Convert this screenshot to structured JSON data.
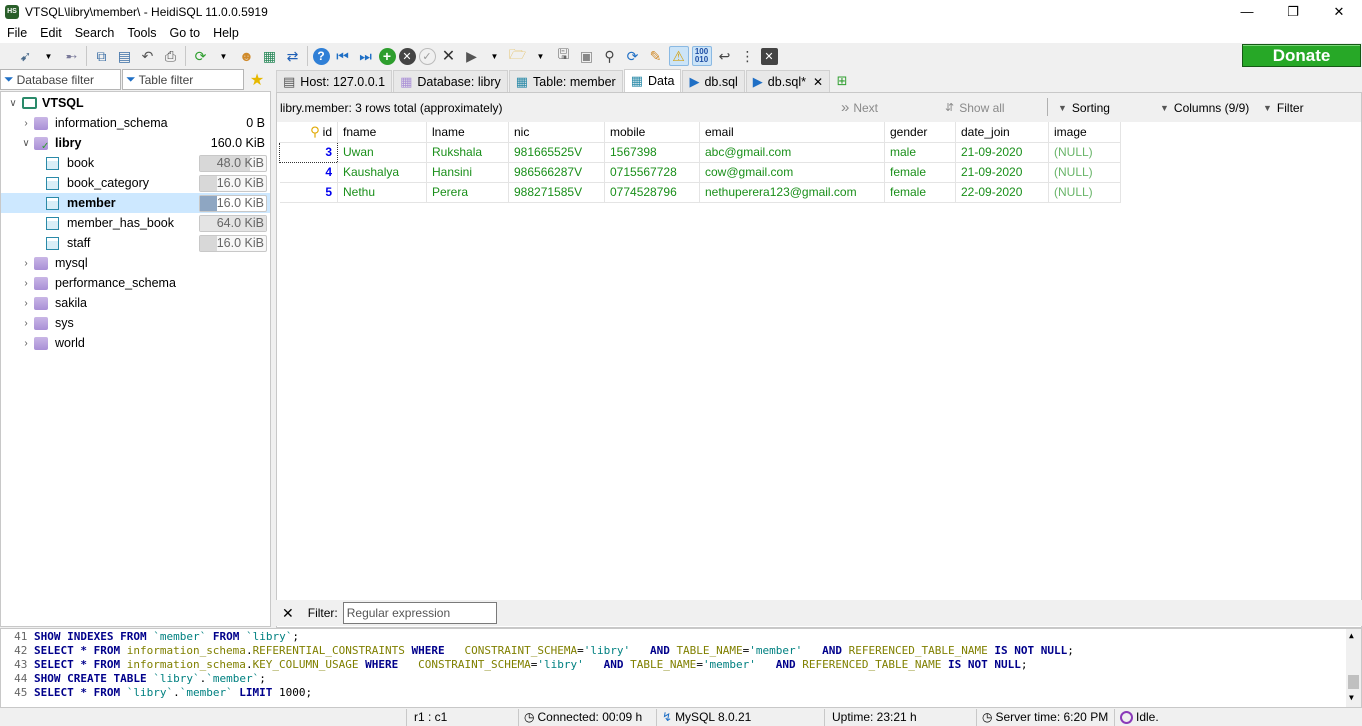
{
  "window": {
    "title": "VTSQL\\libry\\member\\ - HeidiSQL 11.0.0.5919",
    "app_icon_text": "HS"
  },
  "menu": [
    "File",
    "Edit",
    "Search",
    "Tools",
    "Go to",
    "Help"
  ],
  "donate_label": "Donate",
  "filters": {
    "database_filter": "Database filter",
    "table_filter": "Table filter"
  },
  "tabs": [
    {
      "label": "Host: 127.0.0.1",
      "icon": "host-icon"
    },
    {
      "label": "Database: libry",
      "icon": "database-icon"
    },
    {
      "label": "Table: member",
      "icon": "table-icon"
    },
    {
      "label": "Data",
      "icon": "data-grid-icon"
    },
    {
      "label": "db.sql",
      "icon": "play-icon"
    },
    {
      "label": "db.sql*",
      "icon": "play-icon"
    }
  ],
  "tree": {
    "root": "VTSQL",
    "databases": [
      {
        "name": "information_schema",
        "size": "0 B"
      },
      {
        "name": "libry",
        "size": "160.0 KiB",
        "tables": [
          {
            "name": "book",
            "size": "48.0 KiB",
            "fill": 0.75
          },
          {
            "name": "book_category",
            "size": "16.0 KiB",
            "fill": 0.25
          },
          {
            "name": "member",
            "size": "16.0 KiB",
            "fill": 0.25
          },
          {
            "name": "member_has_book",
            "size": "64.0 KiB",
            "fill": 1.0
          },
          {
            "name": "staff",
            "size": "16.0 KiB",
            "fill": 0.25
          }
        ]
      },
      {
        "name": "mysql"
      },
      {
        "name": "performance_schema"
      },
      {
        "name": "sakila"
      },
      {
        "name": "sys"
      },
      {
        "name": "world"
      }
    ]
  },
  "grid": {
    "info": "libry.member: 3 rows total (approximately)",
    "next": "Next",
    "show_all": "Show all",
    "sorting": "Sorting",
    "columns": "Columns (9/9)",
    "filter": "Filter",
    "headers": [
      "id",
      "fname",
      "lname",
      "nic",
      "mobile",
      "email",
      "gender",
      "date_join",
      "image"
    ],
    "rows": [
      [
        "3",
        "Uwan",
        "Rukshala",
        "981665525V",
        "1567398",
        "abc@gmail.com",
        "male",
        "21-09-2020",
        "(NULL)"
      ],
      [
        "4",
        "Kaushalya",
        "Hansini",
        "986566287V",
        "0715567728",
        "cow@gmail.com",
        "female",
        "21-09-2020",
        "(NULL)"
      ],
      [
        "5",
        "Nethu",
        "Perera",
        "988271585V",
        "0774528796",
        "nethuperera123@gmail.com",
        "female",
        "22-09-2020",
        "(NULL)"
      ]
    ]
  },
  "filter_panel": {
    "label": "Filter:",
    "placeholder": "Regular expression"
  },
  "sql_log": [
    {
      "n": "41",
      "parts": [
        [
          "kw",
          "SHOW INDEXES FROM "
        ],
        [
          "str",
          "`member`"
        ],
        [
          "kw",
          " FROM "
        ],
        [
          "str",
          "`libry`"
        ],
        [
          "t",
          ";"
        ]
      ]
    },
    {
      "n": "42",
      "parts": [
        [
          "kw",
          "SELECT * FROM "
        ],
        [
          "obj",
          "information_schema"
        ],
        [
          "t",
          "."
        ],
        [
          "obj",
          "REFERENTIAL_CONSTRAINTS"
        ],
        [
          "kw",
          " WHERE   "
        ],
        [
          "obj",
          "CONSTRAINT_SCHEMA"
        ],
        [
          "t",
          "="
        ],
        [
          "str",
          "'libry'"
        ],
        [
          "kw",
          "   AND "
        ],
        [
          "obj",
          "TABLE_NAME"
        ],
        [
          "t",
          "="
        ],
        [
          "str",
          "'member'"
        ],
        [
          "kw",
          "   AND "
        ],
        [
          "obj",
          "REFERENCED_TABLE_NAME"
        ],
        [
          "kw",
          " IS NOT NULL"
        ],
        [
          "t",
          ";"
        ]
      ]
    },
    {
      "n": "43",
      "parts": [
        [
          "kw",
          "SELECT * FROM "
        ],
        [
          "obj",
          "information_schema"
        ],
        [
          "t",
          "."
        ],
        [
          "obj",
          "KEY_COLUMN_USAGE"
        ],
        [
          "kw",
          " WHERE   "
        ],
        [
          "obj",
          "CONSTRAINT_SCHEMA"
        ],
        [
          "t",
          "="
        ],
        [
          "str",
          "'libry'"
        ],
        [
          "kw",
          "   AND "
        ],
        [
          "obj",
          "TABLE_NAME"
        ],
        [
          "t",
          "="
        ],
        [
          "str",
          "'member'"
        ],
        [
          "kw",
          "   AND "
        ],
        [
          "obj",
          "REFERENCED_TABLE_NAME"
        ],
        [
          "kw",
          " IS NOT NULL"
        ],
        [
          "t",
          ";"
        ]
      ]
    },
    {
      "n": "44",
      "parts": [
        [
          "kw",
          "SHOW CREATE TABLE "
        ],
        [
          "str",
          "`libry`"
        ],
        [
          "t",
          "."
        ],
        [
          "str",
          "`member`"
        ],
        [
          "t",
          ";"
        ]
      ]
    },
    {
      "n": "45",
      "parts": [
        [
          "kw",
          "SELECT * FROM "
        ],
        [
          "str",
          "`libry`"
        ],
        [
          "t",
          "."
        ],
        [
          "str",
          "`member`"
        ],
        [
          "kw",
          " LIMIT "
        ],
        [
          "t",
          "1000;"
        ]
      ]
    }
  ],
  "status": {
    "cursor": "r1 : c1",
    "connected": "Connected: 00:09 h",
    "server": "MySQL 8.0.21",
    "uptime": "Uptime: 23:21 h",
    "server_time": "Server time: 6:20 PM",
    "state": "Idle."
  }
}
